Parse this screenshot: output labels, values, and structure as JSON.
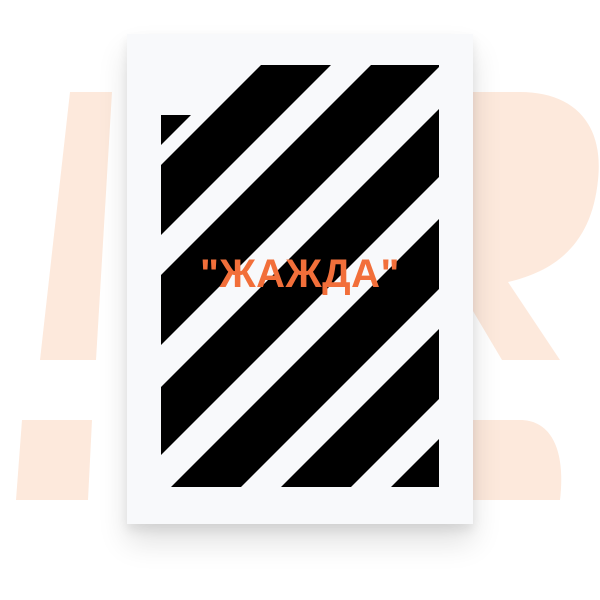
{
  "colors": {
    "background_letters": "#fde9dc",
    "card": "#f8f9fb",
    "stripes": "#000000",
    "title": "#f26f3a"
  },
  "cover": {
    "title": "\"ЖАЖДА\""
  }
}
